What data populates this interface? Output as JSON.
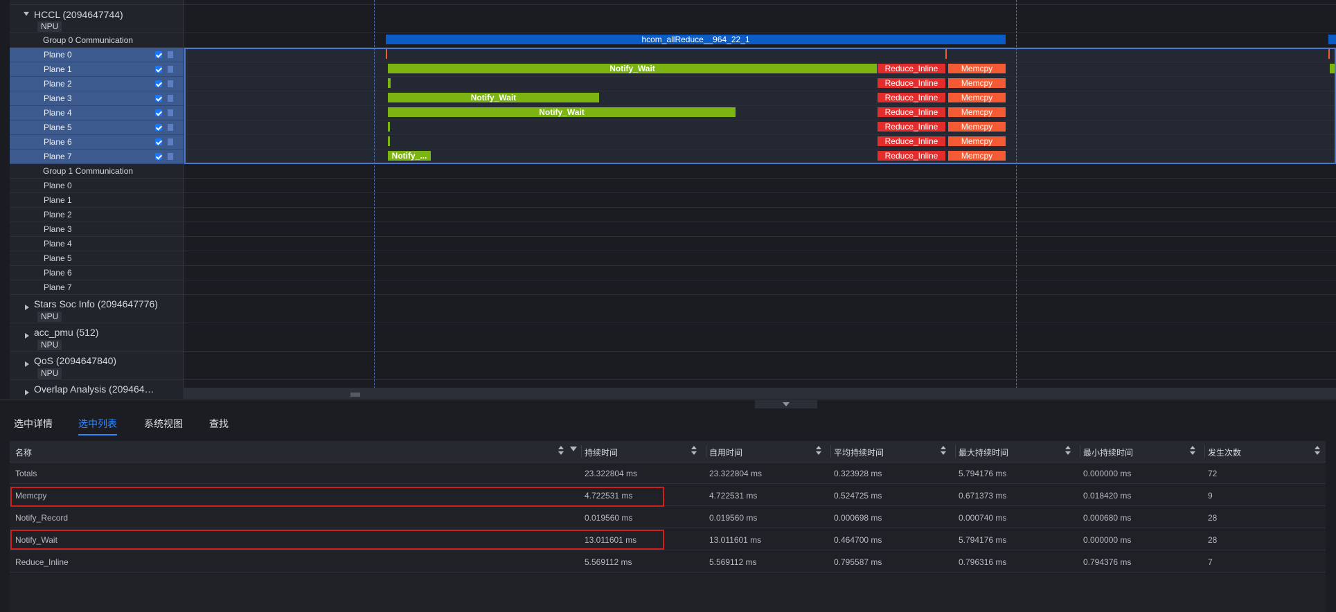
{
  "tree": {
    "hccl": {
      "title": "HCCL (2094647744)",
      "tag": "NPU"
    },
    "group0": "Group 0 Communication",
    "group0_planes": [
      "Plane 0",
      "Plane 1",
      "Plane 2",
      "Plane 3",
      "Plane 4",
      "Plane 5",
      "Plane 6",
      "Plane 7"
    ],
    "group1": "Group 1 Communication",
    "group1_planes": [
      "Plane 0",
      "Plane 1",
      "Plane 2",
      "Plane 3",
      "Plane 4",
      "Plane 5",
      "Plane 6",
      "Plane 7"
    ],
    "stars": {
      "title": "Stars Soc Info (2094647776)",
      "tag": "NPU"
    },
    "accpmu": {
      "title": "acc_pmu (512)",
      "tag": "NPU"
    },
    "qos": {
      "title": "QoS (2094647840)",
      "tag": "NPU"
    },
    "overlap": {
      "title": "Overlap Analysis (209464…"
    }
  },
  "timeline": {
    "group_bar_label": "hcom_allReduce__964_22_1",
    "notify_wait": "Notify_Wait",
    "notify_trunc": "Notify_...",
    "reduce_inline": "Reduce_Inline",
    "memcpy": "Memcpy",
    "colors": {
      "group_bar": "#0b5cc4",
      "notify": "#7cb511",
      "reduce": "#e32d2d",
      "memcpy": "#f45a33"
    }
  },
  "tabs": [
    "选中详情",
    "选中列表",
    "系统视图",
    "查找"
  ],
  "active_tab": "选中列表",
  "table": {
    "headers": [
      "名称",
      "持续时间",
      "自用时间",
      "平均持续时间",
      "最大持续时间",
      "最小持续时间",
      "发生次数"
    ],
    "rows": [
      {
        "name": "Totals",
        "dur": "23.322804 ms",
        "self": "23.322804 ms",
        "avg": "0.323928 ms",
        "max": "5.794176 ms",
        "min": "0.000000 ms",
        "count": "72"
      },
      {
        "name": "Memcpy",
        "dur": "4.722531 ms",
        "self": "4.722531 ms",
        "avg": "0.524725 ms",
        "max": "0.671373 ms",
        "min": "0.018420 ms",
        "count": "9"
      },
      {
        "name": "Notify_Record",
        "dur": "0.019560 ms",
        "self": "0.019560 ms",
        "avg": "0.000698 ms",
        "max": "0.000740 ms",
        "min": "0.000680 ms",
        "count": "28"
      },
      {
        "name": "Notify_Wait",
        "dur": "13.011601 ms",
        "self": "13.011601 ms",
        "avg": "0.464700 ms",
        "max": "5.794176 ms",
        "min": "0.000000 ms",
        "count": "28"
      },
      {
        "name": "Reduce_Inline",
        "dur": "5.569112 ms",
        "self": "5.569112 ms",
        "avg": "0.795587 ms",
        "max": "0.796316 ms",
        "min": "0.794376 ms",
        "count": "7"
      }
    ]
  }
}
